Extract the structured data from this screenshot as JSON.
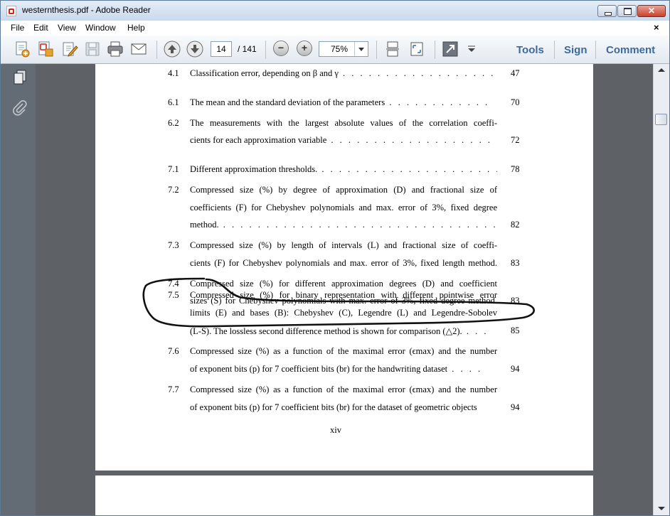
{
  "window": {
    "title": "westernthesis.pdf - Adobe Reader",
    "close_glyph": "✕"
  },
  "menubar": {
    "items": [
      "File",
      "Edit",
      "View",
      "Window",
      "Help"
    ],
    "close_glyph": "×"
  },
  "toolbar": {
    "page_current": "14",
    "page_total": "/ 141",
    "zoom": "75%",
    "zoom_out_glyph": "−",
    "zoom_in_glyph": "+",
    "links": [
      "Tools",
      "Sign",
      "Comment"
    ]
  },
  "document": {
    "entries": [
      {
        "num": "4.1",
        "lines": [
          "Classification error, depending on β and γ"
        ],
        "page": "47"
      },
      {
        "num": "6.1",
        "lines": [
          "The mean and the standard deviation of the parameters"
        ],
        "page": "70"
      },
      {
        "num": "6.2",
        "lines": [
          "The measurements with the largest absolute values of the correlation coeffi-",
          "cients for each approximation variable"
        ],
        "page": "72"
      },
      {
        "num": "7.1",
        "lines": [
          "Different approximation thresholds."
        ],
        "page": "78"
      },
      {
        "num": "7.2",
        "lines": [
          "Compressed size (%) by degree of approximation (D) and fractional size of",
          "coefficients (F) for Chebyshev polynomials and max. error of 3%, fixed degree",
          "method."
        ],
        "page": "82"
      },
      {
        "num": "7.3",
        "lines": [
          "Compressed size (%) by length of intervals (L) and fractional size of coeffi-",
          "cients (F) for Chebyshev polynomials and max. error of 3%, fixed length method."
        ],
        "page": "83"
      },
      {
        "num": "7.4",
        "lines": [
          "Compressed size (%) for different approximation degrees (D) and coefficient",
          "sizes (S) for Chebyshev polynomials with max. error of 3%, fixed degree method."
        ],
        "page": "83"
      },
      {
        "num": "7.5",
        "lines": [
          "Compressed size (%) for binary representation with different pointwise error",
          "limits (E) and bases (B): Chebyshev (C), Legendre (L) and Legendre-Sobolev",
          "(L-S). The lossless second difference method is shown for comparison (△2)."
        ],
        "page": "85"
      },
      {
        "num": "7.6",
        "lines": [
          "Compressed size (%) as a function of the maximal error (ϵmax) and the number",
          "of exponent bits (p) for 7 coefficient bits (br) for the handwriting dataset"
        ],
        "page": "94"
      },
      {
        "num": "7.7",
        "lines": [
          "Compressed size (%) as a function of the maximal error (ϵmax) and the number",
          "of exponent bits (p) for 7 coefficient bits (br) for the dataset of geometric objects"
        ],
        "page": "94"
      }
    ],
    "footer_page": "xiv"
  }
}
